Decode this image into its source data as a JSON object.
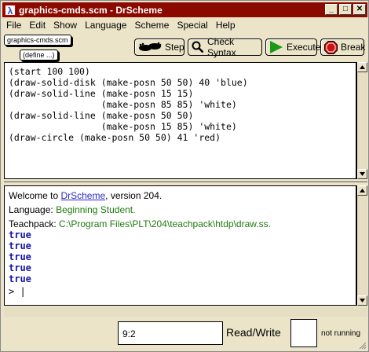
{
  "window": {
    "title": "graphics-cmds.scm - DrScheme",
    "app_icon_glyph": "λ",
    "title_bg": "#8b0a00"
  },
  "window_buttons": {
    "minimize": "_",
    "maximize": "□",
    "close": "✕"
  },
  "menubar": [
    "File",
    "Edit",
    "Show",
    "Language",
    "Scheme",
    "Special",
    "Help"
  ],
  "file_chip": "graphics-cmds.scm",
  "define_chip": "(define ...)",
  "toolbar": {
    "step": {
      "label": "Step",
      "icon": "footprint-icon"
    },
    "check_syntax": {
      "label": "Check Syntax",
      "icon": "magnifier-icon"
    },
    "execute": {
      "label": "Execute",
      "icon": "play-icon",
      "color": "#1a9a1a"
    },
    "break": {
      "label": "Break",
      "icon": "stop-icon",
      "color": "#d01010"
    }
  },
  "definitions": {
    "lines": [
      "(start 100 100)",
      "(draw-solid-disk (make-posn 50 50) 40 'blue)",
      "(draw-solid-line (make-posn 15 15)",
      "                 (make-posn 85 85) 'white)",
      "(draw-solid-line (make-posn 50 50)",
      "                 (make-posn 15 85) 'white)",
      "(draw-circle (make-posn 50 50) 41 'red)"
    ]
  },
  "interactions": {
    "welcome_prefix": "Welcome to ",
    "welcome_link": "DrScheme",
    "welcome_suffix": ", version 204.",
    "language_label": "Language: ",
    "language_value": "Beginning Student.",
    "teachpack_label": "Teachpack: ",
    "teachpack_value": "C:\\Program Files\\PLT\\204\\teachpack\\htdp\\draw.ss.",
    "results": [
      "true",
      "true",
      "true",
      "true",
      "true"
    ],
    "prompt": "> |"
  },
  "status": {
    "position": "9:2",
    "mode": "Read/Write",
    "running": "not running"
  }
}
